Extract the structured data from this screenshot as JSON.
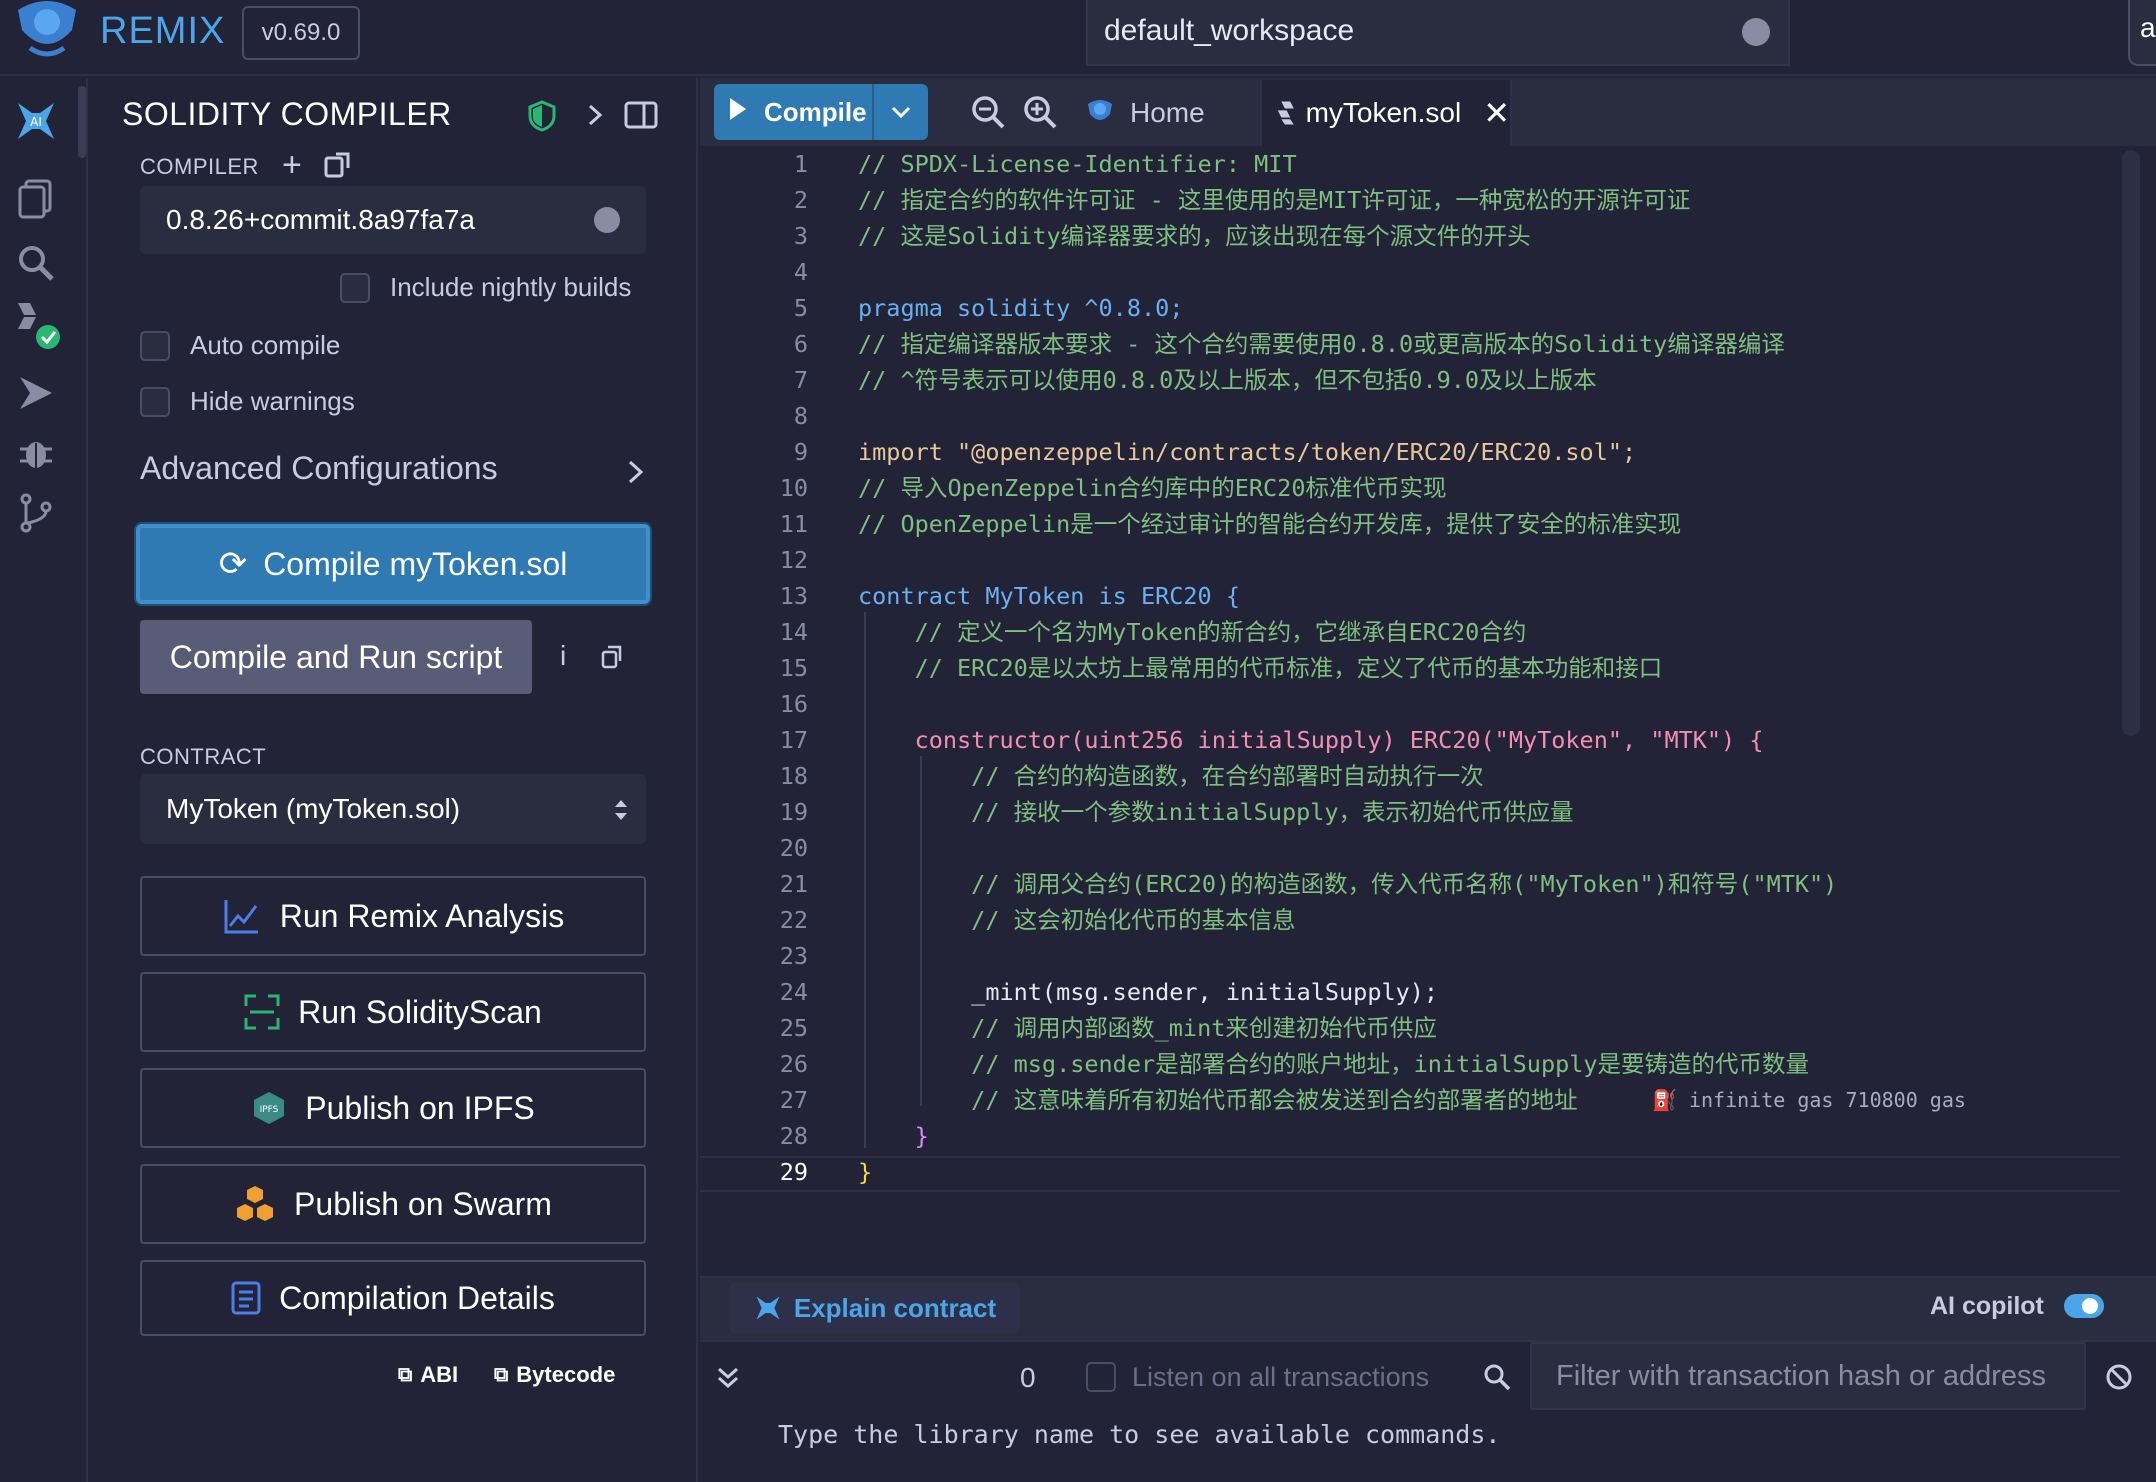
{
  "app": {
    "name": "REMIX",
    "version": "v0.69.0",
    "workspace": "default_workspace",
    "topright_partial": "a"
  },
  "panel": {
    "title": "SOLIDITY COMPILER",
    "compiler_label": "COMPILER",
    "compiler_version": "0.8.26+commit.8a97fa7a",
    "include_nightly": "Include nightly builds",
    "auto_compile": "Auto compile",
    "hide_warnings": "Hide warnings",
    "advanced": "Advanced Configurations",
    "compile_button": "Compile myToken.sol",
    "compile_run_button": "Compile and Run script",
    "contract_label": "CONTRACT",
    "contract_value": "MyToken (myToken.sol)",
    "actions": [
      "Run Remix Analysis",
      "Run SolidityScan",
      "Publish on IPFS",
      "Publish on Swarm",
      "Compilation Details"
    ],
    "abi": "ABI",
    "bytecode": "Bytecode",
    "ipfs_badge": "IPFS"
  },
  "editor": {
    "compile_label": "Compile",
    "tab_home": "Home",
    "tab_file": "myToken.sol",
    "gas_hint": "infinite gas 710800 gas",
    "line_numbers": [
      "1",
      "2",
      "3",
      "4",
      "5",
      "6",
      "7",
      "8",
      "9",
      "10",
      "11",
      "12",
      "13",
      "14",
      "15",
      "16",
      "17",
      "18",
      "19",
      "20",
      "21",
      "22",
      "23",
      "24",
      "25",
      "26",
      "27",
      "28",
      "29"
    ],
    "lines": [
      "// SPDX-License-Identifier: MIT",
      "// 指定合约的软件许可证 - 这里使用的是MIT许可证，一种宽松的开源许可证",
      "// 这是Solidity编译器要求的，应该出现在每个源文件的开头",
      "",
      "pragma solidity ^0.8.0;",
      "// 指定编译器版本要求 - 这个合约需要使用0.8.0或更高版本的Solidity编译器编译",
      "// ^符号表示可以使用0.8.0及以上版本，但不包括0.9.0及以上版本",
      "",
      "import \"@openzeppelin/contracts/token/ERC20/ERC20.sol\";",
      "// 导入OpenZeppelin合约库中的ERC20标准代币实现",
      "// OpenZeppelin是一个经过审计的智能合约开发库，提供了安全的标准实现",
      "",
      "contract MyToken is ERC20 {",
      "    // 定义一个名为MyToken的新合约，它继承自ERC20合约",
      "    // ERC20是以太坊上最常用的代币标准，定义了代币的基本功能和接口",
      "",
      "    constructor(uint256 initialSupply) ERC20(\"MyToken\", \"MTK\") {",
      "        // 合约的构造函数，在合约部署时自动执行一次",
      "        // 接收一个参数initialSupply，表示初始代币供应量",
      "",
      "        // 调用父合约(ERC20)的构造函数，传入代币名称(\"MyToken\")和符号(\"MTK\")",
      "        // 这会初始化代币的基本信息",
      "",
      "        _mint(msg.sender, initialSupply);",
      "        // 调用内部函数_mint来创建初始代币供应",
      "        // msg.sender是部署合约的账户地址，initialSupply是要铸造的代币数量",
      "        // 这意味着所有初始代币都会被发送到合约部署者的地址",
      "    }",
      "}"
    ]
  },
  "bottom": {
    "explain_contract": "Explain contract",
    "ai_copilot": "AI copilot",
    "tx_count": "0",
    "listen_all": "Listen on all transactions",
    "filter_placeholder": "Filter with transaction hash or address",
    "terminal_text": "Type the library name to see available commands."
  }
}
